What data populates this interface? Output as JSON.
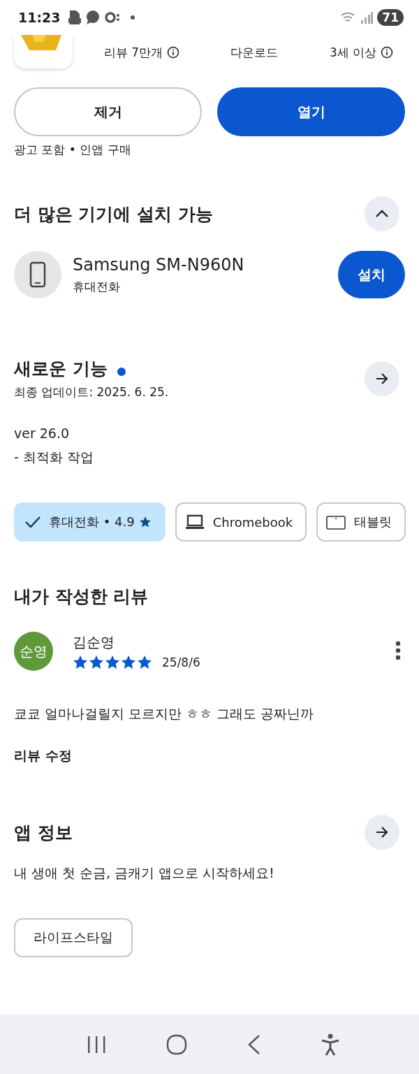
{
  "status_bar": {
    "time": "11:23",
    "battery": "71"
  },
  "app_header": {
    "stats": [
      {
        "text": "리뷰 7만개",
        "info": true
      },
      {
        "text": "다운로드",
        "info": false
      },
      {
        "text": "3세 이상",
        "info": true
      }
    ]
  },
  "actions": [
    {
      "label": "제거",
      "kind": "outline"
    },
    {
      "label": "열기",
      "kind": "filled"
    }
  ],
  "notice": "광고 포함 • 인앱 구매",
  "devices_section": {
    "title": "더 많은 기기에 설치 가능",
    "expanded": true,
    "device": {
      "name": "Samsung SM-N960N",
      "type": "휴대전화",
      "button": "설치"
    }
  },
  "whats_new": {
    "title": "새로운 기능",
    "new_dot": true,
    "updated": "최종 업데이트: 2025. 6. 25.",
    "lines": [
      "ver 26.0",
      "- 최적화 작업"
    ]
  },
  "device_chips": [
    {
      "label": "휴대전화 • 4.9",
      "kind": "phone",
      "selected": true
    },
    {
      "label": "Chromebook",
      "kind": "laptop",
      "selected": false
    },
    {
      "label": "태블릿",
      "kind": "tablet",
      "selected": false
    }
  ],
  "my_review": {
    "title": "내가 작성한 리뷰",
    "initials": "순영",
    "color": "#5e9a3c",
    "name": "김순영",
    "stars": 5,
    "date": "25/8/6",
    "text": "쿄쿄 얼마나걸릴지 모르지만 ㅎㅎ 그래도 공짜닌까",
    "edit": "리뷰 수정"
  },
  "app_info": {
    "title": "앱 정보",
    "description": "내 생애 첫 순금, 금캐기 앱으로 시작하세요!",
    "category": "라이프스타일"
  }
}
